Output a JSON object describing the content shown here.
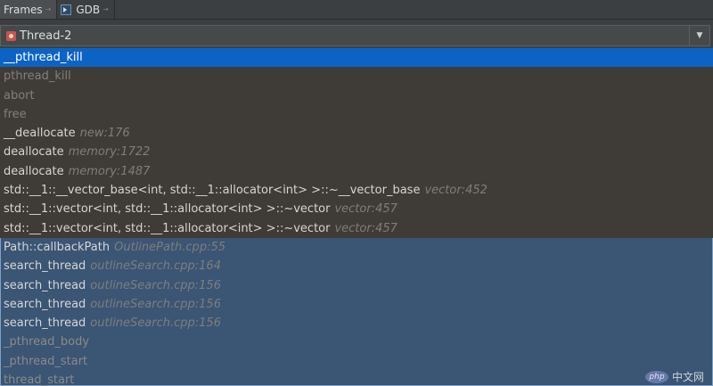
{
  "tabs": [
    {
      "label": "Frames",
      "pin": "⇢",
      "icon": "frames-icon"
    },
    {
      "label": "GDB",
      "pin": "⇢",
      "icon": "gdb-console-icon"
    }
  ],
  "thread_selector": {
    "icon": "thread-icon",
    "value": "Thread-2",
    "arrow": "▼"
  },
  "frames": [
    {
      "fn": "__pthread_kill",
      "loc": ""
    },
    {
      "fn": "pthread_kill",
      "loc": ""
    },
    {
      "fn": "abort",
      "loc": ""
    },
    {
      "fn": "free",
      "loc": ""
    },
    {
      "fn": "__deallocate",
      "loc": "new:176"
    },
    {
      "fn": "deallocate",
      "loc": "memory:1722"
    },
    {
      "fn": "deallocate",
      "loc": "memory:1487"
    },
    {
      "fn": "std::__1::__vector_base<int, std::__1::allocator<int> >::~__vector_base",
      "loc": "vector:452"
    },
    {
      "fn": "std::__1::vector<int, std::__1::allocator<int> >::~vector",
      "loc": "vector:457"
    },
    {
      "fn": "std::__1::vector<int, std::__1::allocator<int> >::~vector",
      "loc": "vector:457"
    },
    {
      "fn": "Path::callbackPath",
      "loc": "OutlinePath.cpp:55"
    },
    {
      "fn": "search_thread",
      "loc": "outlineSearch.cpp:164"
    },
    {
      "fn": "search_thread",
      "loc": "outlineSearch.cpp:156"
    },
    {
      "fn": "search_thread",
      "loc": "outlineSearch.cpp:156"
    },
    {
      "fn": "search_thread",
      "loc": "outlineSearch.cpp:156"
    },
    {
      "fn": "_pthread_body",
      "loc": ""
    },
    {
      "fn": "_pthread_start",
      "loc": ""
    },
    {
      "fn": "thread_start",
      "loc": ""
    }
  ],
  "watermark": {
    "logo": "php",
    "text": "中文网"
  }
}
